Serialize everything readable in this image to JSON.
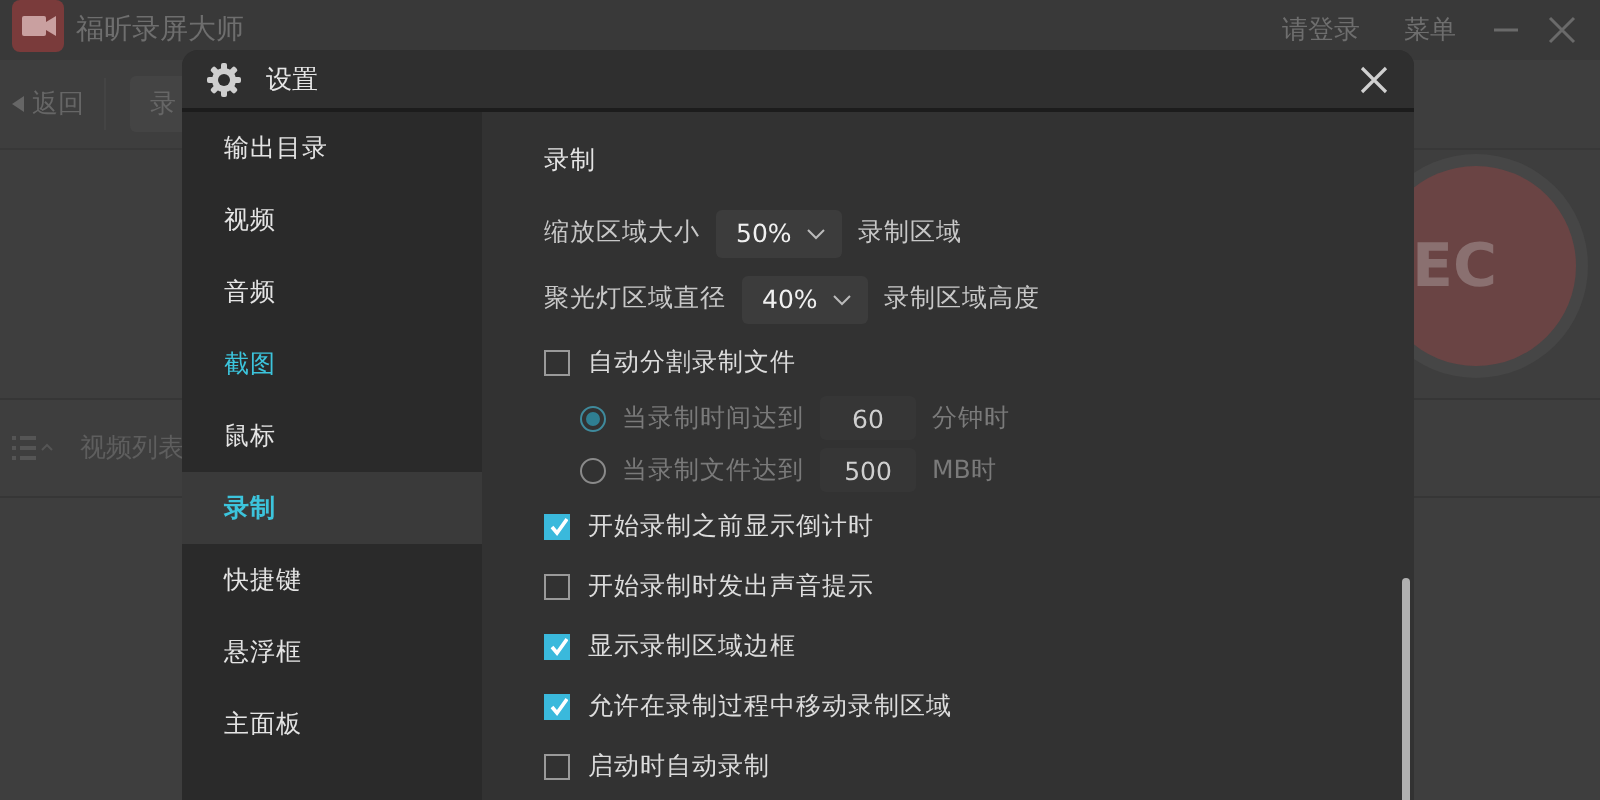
{
  "app": {
    "title": "福昕录屏大师",
    "login": "请登录",
    "menu": "菜单",
    "back": "返回",
    "tab": "录",
    "rec_label": "EC",
    "video_list": "视频列表"
  },
  "dialog": {
    "title": "设置",
    "sidebar": [
      {
        "label": "输出目录",
        "selected": false,
        "hovered": false
      },
      {
        "label": "视频",
        "selected": false,
        "hovered": false
      },
      {
        "label": "音频",
        "selected": false,
        "hovered": false
      },
      {
        "label": "截图",
        "selected": false,
        "hovered": true
      },
      {
        "label": "鼠标",
        "selected": false,
        "hovered": false
      },
      {
        "label": "录制",
        "selected": true,
        "hovered": false
      },
      {
        "label": "快捷键",
        "selected": false,
        "hovered": false
      },
      {
        "label": "悬浮框",
        "selected": false,
        "hovered": false
      },
      {
        "label": "主面板",
        "selected": false,
        "hovered": false
      }
    ],
    "section_title": "录制",
    "rows": [
      {
        "kind": "dropdown",
        "label": "缩放区域大小",
        "value": "50%",
        "suffix": "录制区域"
      },
      {
        "kind": "dropdown",
        "label": "聚光灯区域直径",
        "value": "40%",
        "suffix": "录制区域高度"
      },
      {
        "kind": "checkbox",
        "label": "自动分割录制文件",
        "checked": false
      },
      {
        "kind": "radio",
        "label": "当录制时间达到",
        "selected": true,
        "disabled": true,
        "value": "60",
        "unit": "分钟时"
      },
      {
        "kind": "radio",
        "label": "当录制文件达到",
        "selected": false,
        "disabled": true,
        "value": "500",
        "unit": "MB时"
      },
      {
        "kind": "checkbox",
        "label": "开始录制之前显示倒计时",
        "checked": true
      },
      {
        "kind": "checkbox",
        "label": "开始录制时发出声音提示",
        "checked": false
      },
      {
        "kind": "checkbox",
        "label": "显示录制区域边框",
        "checked": true
      },
      {
        "kind": "checkbox",
        "label": "允许在录制过程中移动录制区域",
        "checked": true
      },
      {
        "kind": "checkbox",
        "label": "启动时自动录制",
        "checked": false
      }
    ]
  }
}
